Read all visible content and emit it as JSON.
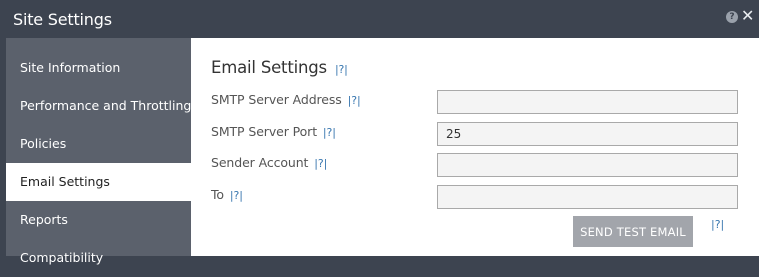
{
  "window": {
    "title": "Site Settings",
    "help_glyph": "?",
    "close_glyph": "✕"
  },
  "sidebar": {
    "items": [
      {
        "label": "Site Information"
      },
      {
        "label": "Performance and Throttling"
      },
      {
        "label": "Policies"
      },
      {
        "label": "Email Settings",
        "active": true
      },
      {
        "label": "Reports"
      },
      {
        "label": "Compatibility"
      }
    ]
  },
  "main": {
    "section_title": "Email Settings",
    "help_link": "|?|",
    "fields": [
      {
        "label": "SMTP Server Address",
        "value": ""
      },
      {
        "label": "SMTP Server Port",
        "value": "25"
      },
      {
        "label": "Sender Account",
        "value": ""
      },
      {
        "label": "To",
        "value": ""
      }
    ],
    "send_test_button": "SEND TEST EMAIL"
  },
  "colors": {
    "titlebar": "#3d4450",
    "sidebar": "#5b616c",
    "active_item": "#ffffff",
    "help_link": "#3a78b0",
    "button": "#a2a5ab"
  }
}
